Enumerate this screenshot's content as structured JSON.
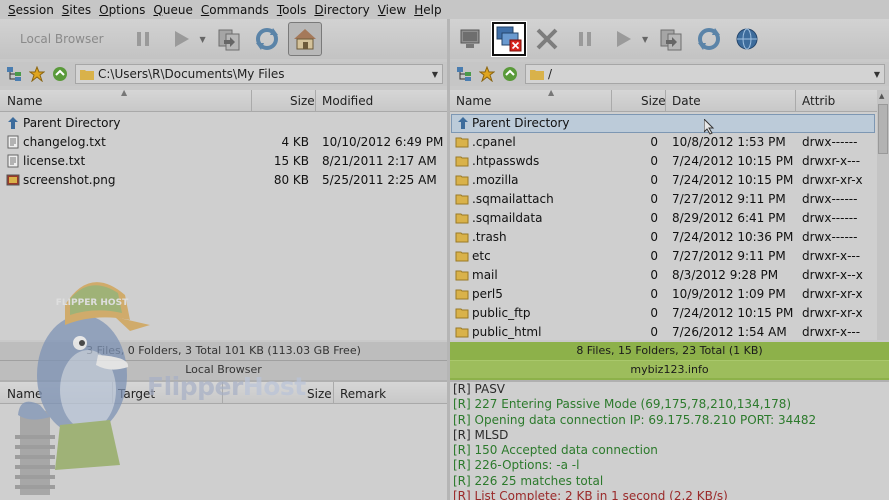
{
  "menu": [
    "Session",
    "Sites",
    "Options",
    "Queue",
    "Commands",
    "Tools",
    "Directory",
    "View",
    "Help"
  ],
  "left_toolbar": {
    "label": "Local Browser"
  },
  "left_path": "C:\\Users\\R\\Documents\\My Files",
  "right_path": "/",
  "left_columns": [
    "Name",
    "Size",
    "Modified"
  ],
  "right_columns": [
    "Name",
    "Size",
    "Date",
    "Attrib"
  ],
  "parent_dir": "Parent Directory",
  "left_files": [
    {
      "name": "changelog.txt",
      "size": "4 KB",
      "modified": "10/10/2012 6:49 PM"
    },
    {
      "name": "license.txt",
      "size": "15 KB",
      "modified": "8/21/2011 2:17 AM"
    },
    {
      "name": "screenshot.png",
      "size": "80 KB",
      "modified": "5/25/2011 2:25 AM"
    }
  ],
  "right_files": [
    {
      "name": ".cpanel",
      "size": "0",
      "date": "10/8/2012 1:53 PM",
      "attrib": "drwx------"
    },
    {
      "name": ".htpasswds",
      "size": "0",
      "date": "7/24/2012 10:15 PM",
      "attrib": "drwxr-x---"
    },
    {
      "name": ".mozilla",
      "size": "0",
      "date": "7/24/2012 10:15 PM",
      "attrib": "drwxr-xr-x"
    },
    {
      "name": ".sqmailattach",
      "size": "0",
      "date": "7/27/2012 9:11 PM",
      "attrib": "drwx------"
    },
    {
      "name": ".sqmaildata",
      "size": "0",
      "date": "8/29/2012 6:41 PM",
      "attrib": "drwx------"
    },
    {
      "name": ".trash",
      "size": "0",
      "date": "7/24/2012 10:36 PM",
      "attrib": "drwx------"
    },
    {
      "name": "etc",
      "size": "0",
      "date": "7/27/2012 9:11 PM",
      "attrib": "drwxr-x---"
    },
    {
      "name": "mail",
      "size": "0",
      "date": "8/3/2012 9:28 PM",
      "attrib": "drwxr-x--x"
    },
    {
      "name": "perl5",
      "size": "0",
      "date": "10/9/2012 1:09 PM",
      "attrib": "drwxr-xr-x"
    },
    {
      "name": "public_ftp",
      "size": "0",
      "date": "7/24/2012 10:15 PM",
      "attrib": "drwxr-xr-x"
    },
    {
      "name": "public_html",
      "size": "0",
      "date": "7/26/2012 1:54 AM",
      "attrib": "drwxr-x---"
    }
  ],
  "left_status": {
    "summary": "3 Files, 0 Folders, 3 Total 101 KB (113.03 GB Free)",
    "label": "Local Browser"
  },
  "right_status": {
    "summary": "8 Files, 15 Folders, 23 Total (1 KB)",
    "label": "mybiz123.info"
  },
  "queue_columns": [
    "Name",
    "Target",
    "Size",
    "Remark"
  ],
  "log": [
    {
      "text": "[R] PASV",
      "kind": "cmd"
    },
    {
      "text": "[R] 227 Entering Passive Mode (69,175,78,210,134,178)",
      "kind": "ok"
    },
    {
      "text": "[R] Opening data connection IP: 69.175.78.210 PORT: 34482",
      "kind": "ok"
    },
    {
      "text": "[R] MLSD",
      "kind": "cmd"
    },
    {
      "text": "[R] 150 Accepted data connection",
      "kind": "ok"
    },
    {
      "text": "[R] 226-Options: -a -l",
      "kind": "ok"
    },
    {
      "text": "[R] 226 25 matches total",
      "kind": "ok"
    },
    {
      "text": "[R] List Complete: 2 KB in 1 second (2.2 KB/s)",
      "kind": "err"
    }
  ],
  "brand": {
    "part1": "Flipper",
    "part2": "Host",
    "cap": "FLIPPER HOST"
  },
  "colors": {
    "ok": "#2c7a2c",
    "cmd": "#2b2b2b",
    "err": "#9a2a2a",
    "status_remote": "#8db14a"
  }
}
